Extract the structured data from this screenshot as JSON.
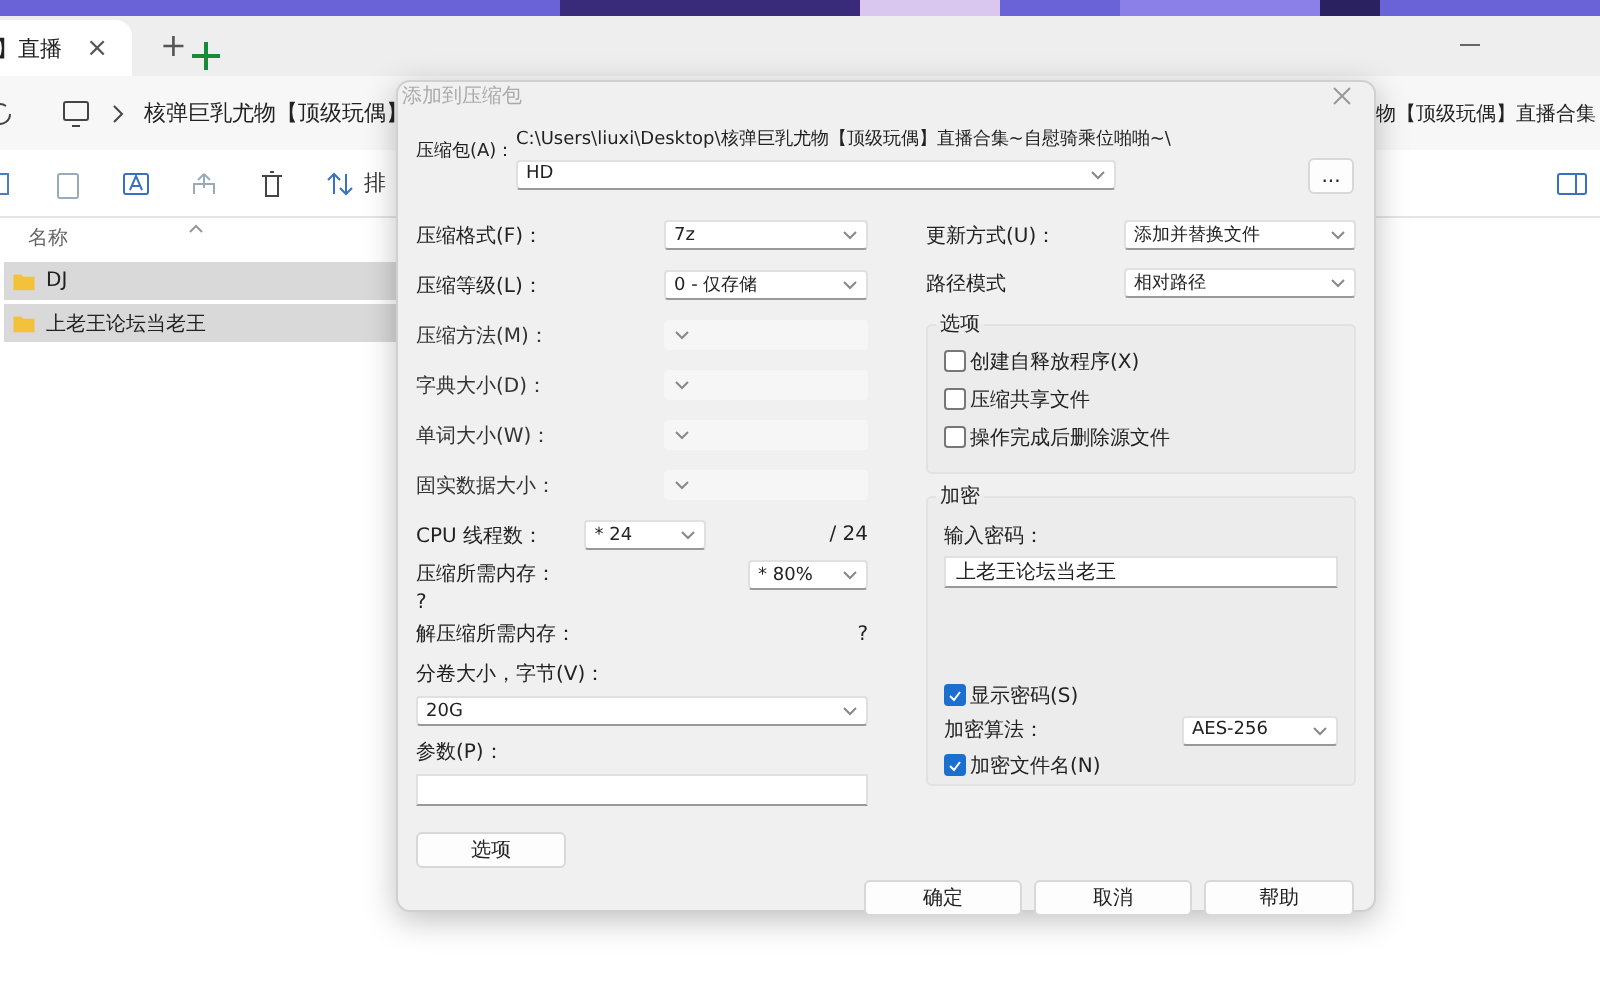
{
  "wallpaper": {
    "kind": "picture"
  },
  "tabs": [
    {
      "label": "】直播",
      "close": "×",
      "selected": true
    }
  ],
  "new_tab": "+",
  "address": {
    "left": "核弹巨乳尤物【顶级玩偶】",
    "right": "物【顶级玩偶】直播合集"
  },
  "toolbar": {
    "sort_label": "排"
  },
  "columns": [
    "名称"
  ],
  "files": [
    {
      "name": "DJ",
      "selected": true
    },
    {
      "name": "上老王论坛当老王",
      "selected": true
    }
  ],
  "dialog": {
    "title": "添加到压缩包",
    "archive_label": "压缩包(A)：",
    "archive_path": "C:\\Users\\liuxi\\Desktop\\核弹巨乳尤物【顶级玩偶】直播合集~自慰骑乘位啪啪~\\",
    "archive_name": "HD",
    "browse": "...",
    "left": [
      {
        "kind": "combo",
        "label": "压缩格式(F)：",
        "value": "7z",
        "disabled": false
      },
      {
        "kind": "combo",
        "label": "压缩等级(L)：",
        "value": "0 - 仅存储",
        "disabled": false
      },
      {
        "kind": "combo",
        "label": "压缩方法(M)：",
        "disabled": true
      },
      {
        "kind": "combo",
        "label": "字典大小(D)：",
        "disabled": true
      },
      {
        "kind": "combo",
        "label": "单词大小(W)：",
        "disabled": true
      },
      {
        "kind": "combo",
        "label": "固实数据大小：",
        "disabled": true
      },
      {
        "kind": "threads",
        "label": "CPU 线程数：",
        "value": "* 24",
        "suffix": "/ 24",
        "disabled": false
      },
      {
        "kind": "memory",
        "label": "压缩所需内存：",
        "note": "?",
        "value": "* 80%",
        "disabled": false
      },
      {
        "kind": "info",
        "label": "解压缩所需内存：",
        "note": "?"
      }
    ],
    "volume_label": "分卷大小，字节(V)：",
    "volume_value": "20G",
    "params_label": "参数(P)：",
    "options_button": "选项",
    "update_label": "更新方式(U)：",
    "update_value": "添加并替换文件",
    "path_label": "路径模式",
    "path_value": "相对路径",
    "options_group": {
      "title": "选项",
      "items": [
        {
          "label": "创建自释放程序(X)",
          "checked": false
        },
        {
          "label": "压缩共享文件",
          "checked": false
        },
        {
          "label": "操作完成后删除源文件",
          "checked": false
        }
      ]
    },
    "encryption": {
      "title": "加密",
      "password_label": "输入密码：",
      "password": "上老王论坛当老王",
      "show_password": {
        "label": "显示密码(S)",
        "checked": true
      },
      "method_label": "加密算法：",
      "method_value": "AES-256",
      "encrypt_names": {
        "label": "加密文件名(N)",
        "checked": true
      }
    },
    "buttons": [
      "确定",
      "取消",
      "帮助"
    ]
  }
}
